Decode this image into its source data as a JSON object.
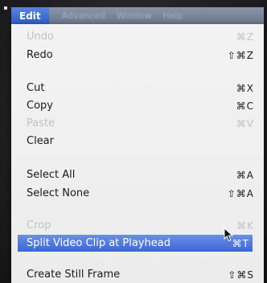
{
  "menubar": {
    "active_menu": "Edit",
    "other_menus": [
      "Advanced",
      "Window",
      "Help"
    ]
  },
  "edit_menu": {
    "items": [
      {
        "label": "Undo",
        "shortcut": "⌘Z",
        "enabled": false
      },
      {
        "label": "Redo",
        "shortcut": "⇧⌘Z",
        "enabled": true
      },
      {
        "label": "Cut",
        "shortcut": "⌘X",
        "enabled": true
      },
      {
        "label": "Copy",
        "shortcut": "⌘C",
        "enabled": true
      },
      {
        "label": "Paste",
        "shortcut": "⌘V",
        "enabled": false
      },
      {
        "label": "Clear",
        "shortcut": "",
        "enabled": true
      },
      {
        "label": "Select All",
        "shortcut": "⌘A",
        "enabled": true
      },
      {
        "label": "Select None",
        "shortcut": "⇧⌘A",
        "enabled": true
      },
      {
        "label": "Crop",
        "shortcut": "⌘K",
        "enabled": false
      },
      {
        "label": "Split Video Clip at Playhead",
        "shortcut": "⌘T",
        "enabled": true,
        "highlighted": true
      },
      {
        "label": "Create Still Frame",
        "shortcut": "⇧⌘S",
        "enabled": true
      }
    ]
  },
  "colors": {
    "menubar": "#7a8499",
    "highlight": "#4a72dc",
    "menu_bg": "#efefef",
    "disabled_text": "#c2c2c2"
  }
}
